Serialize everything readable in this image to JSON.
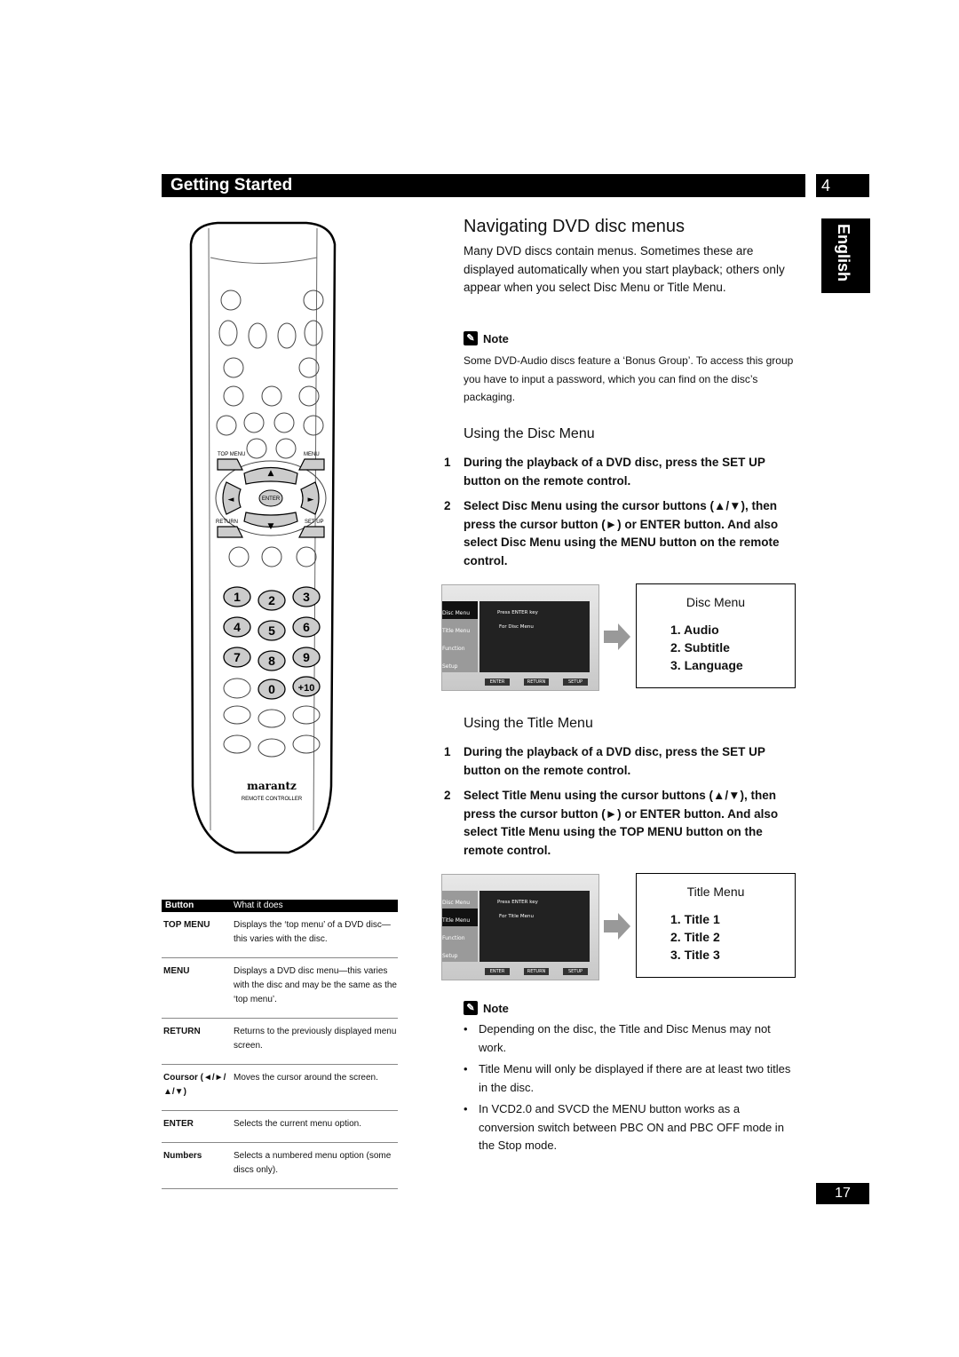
{
  "header": {
    "section_title": "Getting Started",
    "chapter_number": "4",
    "language_tab": "English"
  },
  "main": {
    "title": "Navigating DVD disc menus",
    "intro": "Many DVD discs contain menus. Sometimes these are displayed automatically when you start playback; others only appear when you select Disc Menu or Title Menu.",
    "note1": {
      "label": "Note",
      "text": "Some DVD-Audio discs feature a ‘Bonus Group’. To access this group you have to input a password, which you can find on the disc’s packaging."
    },
    "disc_menu_section": {
      "heading": "Using the Disc Menu",
      "steps": [
        {
          "num": "1",
          "text": "During the playback of a DVD disc, press the SET UP button on the remote control."
        },
        {
          "num": "2",
          "text": "Select Disc Menu using the cursor buttons (▲/▼), then press the cursor button (►) or ENTER button. And also select Disc Menu using the MENU button on the remote control."
        }
      ],
      "screen": {
        "items": [
          "Disc Menu",
          "Title Menu",
          "Function",
          "Setup"
        ],
        "selected": "Disc Menu",
        "line1": "Press ENTER key",
        "line2": "For Disc Menu",
        "buttons": [
          "ENTER",
          "RETURN",
          "SETUP"
        ]
      },
      "menu_box": {
        "title": "Disc Menu",
        "items": [
          "1.  Audio",
          "2.  Subtitle",
          "3.  Language"
        ]
      }
    },
    "title_menu_section": {
      "heading": "Using the Title Menu",
      "steps": [
        {
          "num": "1",
          "text": "During the playback of a DVD disc, press the SET UP button on the remote control."
        },
        {
          "num": "2",
          "text": "Select Title Menu using the cursor buttons (▲/▼), then press the cursor button (►) or ENTER button. And also select Title Menu using the TOP MENU button on the remote control."
        }
      ],
      "screen": {
        "items": [
          "Disc Menu",
          "Title Menu",
          "Function",
          "Setup"
        ],
        "selected": "Title Menu",
        "line1": "Press ENTER key",
        "line2": "For Title Menu",
        "buttons": [
          "ENTER",
          "RETURN",
          "SETUP"
        ]
      },
      "menu_box": {
        "title": "Title Menu",
        "items": [
          "1.  Title 1",
          "2.  Title 2",
          "3.  Title 3"
        ]
      }
    },
    "note2": {
      "label": "Note",
      "bullets": [
        "Depending on the disc, the Title and Disc Menus may not work.",
        "Title Menu will only be displayed if there are at least two titles in the disc.",
        "In VCD2.0 and SVCD the MENU button works as a conversion switch between PBC ON and PBC OFF mode in the Stop mode."
      ]
    }
  },
  "remote": {
    "labels": {
      "top_menu": "TOP MENU",
      "menu": "MENU",
      "return": "RETURN",
      "setup": "SET UP",
      "enter": "ENTER"
    },
    "numbers": [
      "1",
      "2",
      "3",
      "4",
      "5",
      "6",
      "7",
      "8",
      "9",
      "0",
      "+10"
    ],
    "brand": "marantz",
    "model_text": "REMOTE CONTROLLER"
  },
  "table": {
    "headers": [
      "Button",
      "What it does"
    ],
    "rows": [
      {
        "button": "TOP MENU",
        "desc": "Displays the ‘top menu’ of a DVD disc—this varies with the disc."
      },
      {
        "button": "MENU",
        "desc": "Displays a DVD disc menu—this varies with the disc and may be the same as the ‘top menu’."
      },
      {
        "button": "RETURN",
        "desc": "Returns to the previously displayed menu screen."
      },
      {
        "button": "Coursor (◄/►/▲/▼)",
        "desc": "Moves the cursor around the screen."
      },
      {
        "button": "ENTER",
        "desc": "Selects the current menu option."
      },
      {
        "button": "Numbers",
        "desc": "Selects a numbered menu option (some discs only)."
      }
    ]
  },
  "footer": {
    "page_number": "17"
  }
}
